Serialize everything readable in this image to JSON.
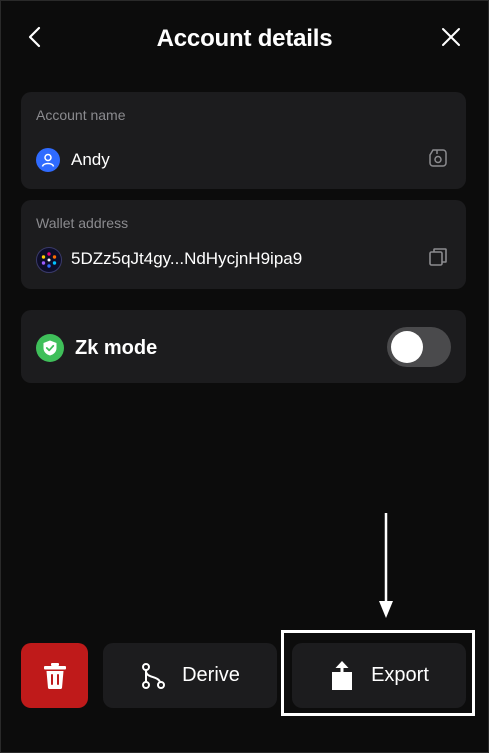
{
  "header": {
    "title": "Account details"
  },
  "account_name": {
    "label": "Account name",
    "value": "Andy"
  },
  "wallet_address": {
    "label": "Wallet address",
    "value": "5DZz5qJt4gy...NdHycjnH9ipa9"
  },
  "zk_mode": {
    "label": "Zk mode",
    "enabled": false
  },
  "footer": {
    "derive_label": "Derive",
    "export_label": "Export"
  },
  "colors": {
    "background": "#0c0c0c",
    "card": "#1c1c1e",
    "delete": "#bf1a1a",
    "zk_shield": "#3fbf5a",
    "avatar_blue": "#2f6bff"
  },
  "icons": {
    "back": "chevron-left-icon",
    "close": "close-icon",
    "avatar": "user-icon",
    "edit": "edit-icon",
    "wallet": "polkadot-icon",
    "copy": "copy-icon",
    "shield": "shield-check-icon",
    "trash": "trash-icon",
    "derive": "branch-icon",
    "export": "upload-icon"
  }
}
